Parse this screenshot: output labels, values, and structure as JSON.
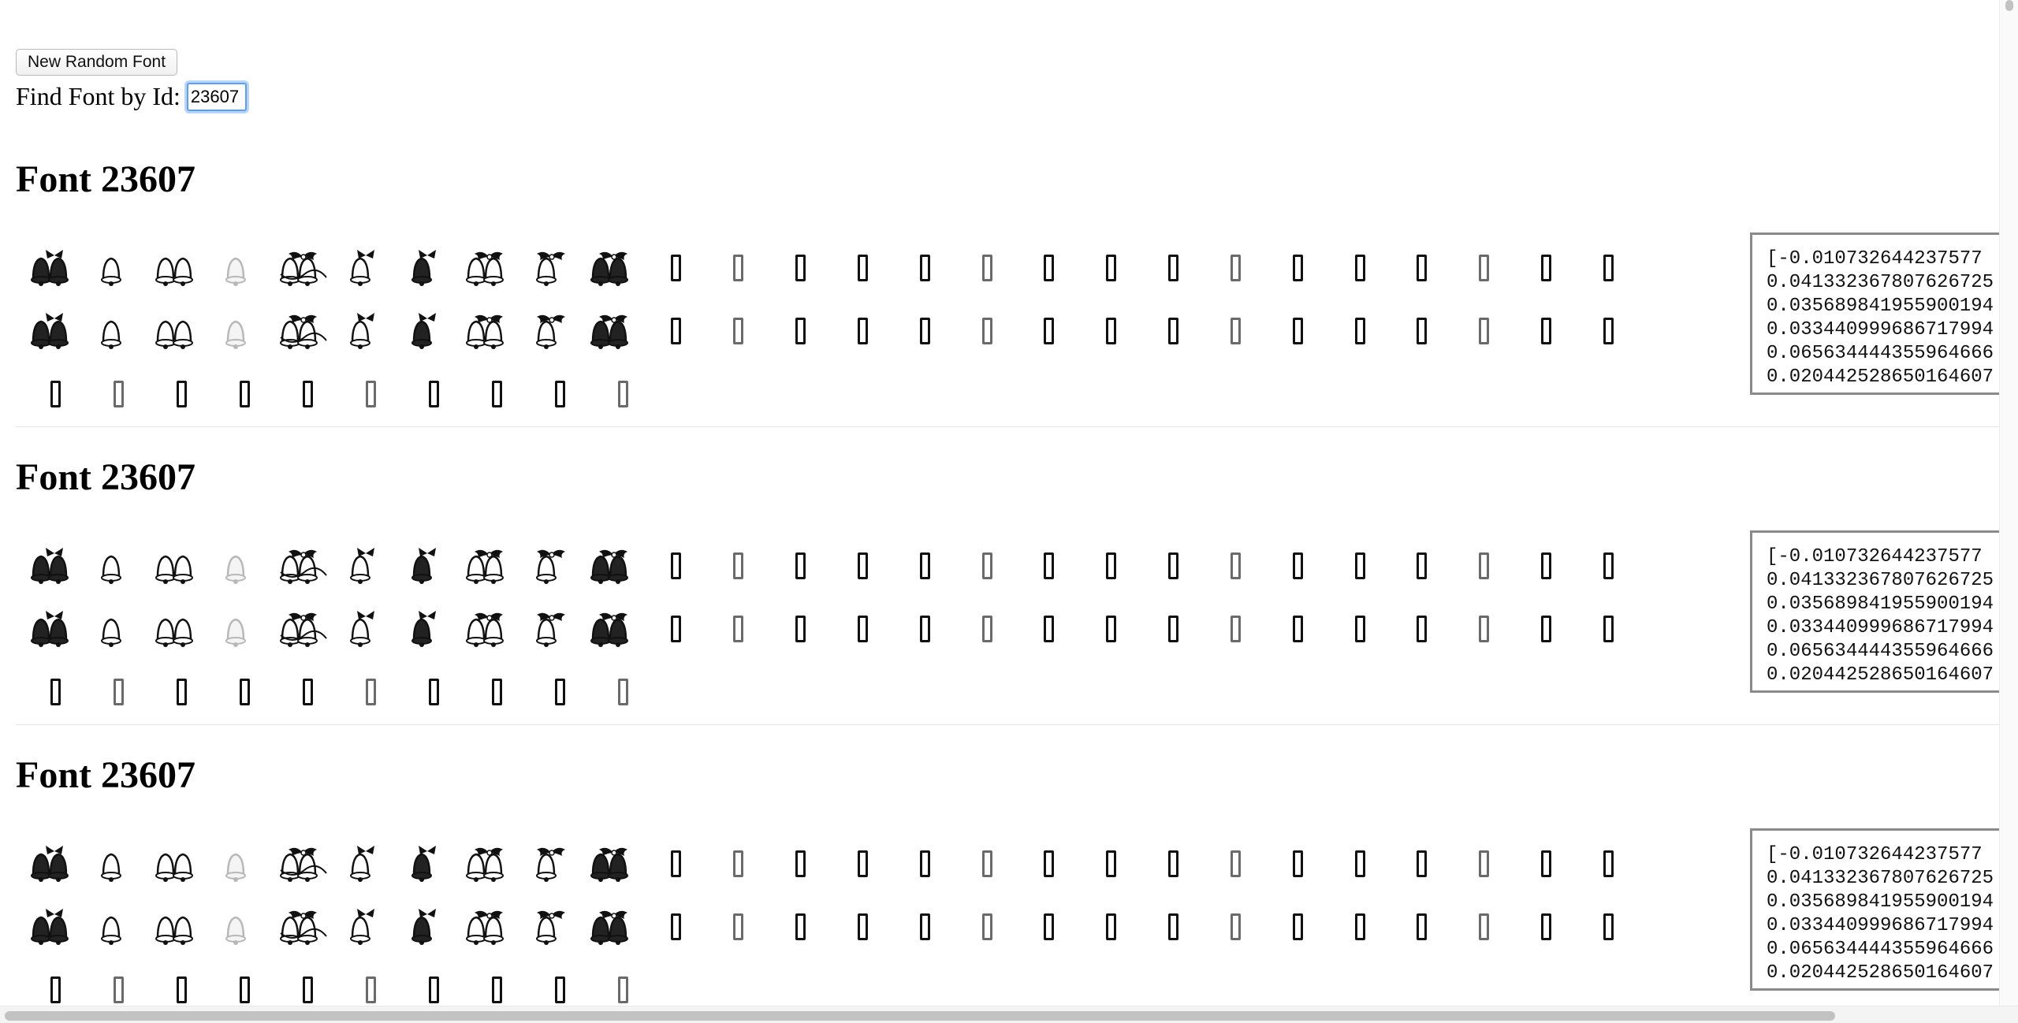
{
  "controls": {
    "random_button_label": "New Random Font",
    "find_label": "Find Font by Id:",
    "find_value": "23607"
  },
  "sections": [
    {
      "title": "Font 23607",
      "vector_lines": [
        "[-0.010732644237577",
        "0.041332367807626725",
        "0.035689841955900194",
        "0.033440999686717994",
        "0.065634444355964666",
        "0.020442528650164607"
      ]
    },
    {
      "title": "Font 23607",
      "vector_lines": [
        "[-0.010732644237577",
        "0.041332367807626725",
        "0.035689841955900194",
        "0.033440999686717994",
        "0.065634444355964666",
        "0.020442528650164607"
      ]
    },
    {
      "title": "Font 23607",
      "vector_lines": [
        "[-0.010732644237577",
        "0.041332367807626725",
        "0.035689841955900194",
        "0.033440999686717994",
        "0.065634444355964666",
        "0.020442528650164607"
      ]
    }
  ],
  "glyph_rows": [
    {
      "icons": [
        "bells-bow-icon",
        "bell-small-icon",
        "bells-outline-icon",
        "bell-faint-icon",
        "bells-garland-icon",
        "bell-ribbon-icon",
        "bell-bow-icon",
        "bells-holly-icon",
        "holly-leaves-icon",
        "bells-bouquet-icon"
      ],
      "tofu_count": 16
    },
    {
      "icons": [
        "bells-bow-icon",
        "bell-small-icon",
        "bells-outline-icon",
        "bell-faint-icon",
        "bells-garland-icon",
        "bell-ribbon-icon",
        "bell-bow-icon",
        "bells-holly-icon",
        "holly-leaves-icon",
        "bells-bouquet-icon"
      ],
      "tofu_count": 16
    },
    {
      "icons": [],
      "tofu_count": 10
    }
  ]
}
